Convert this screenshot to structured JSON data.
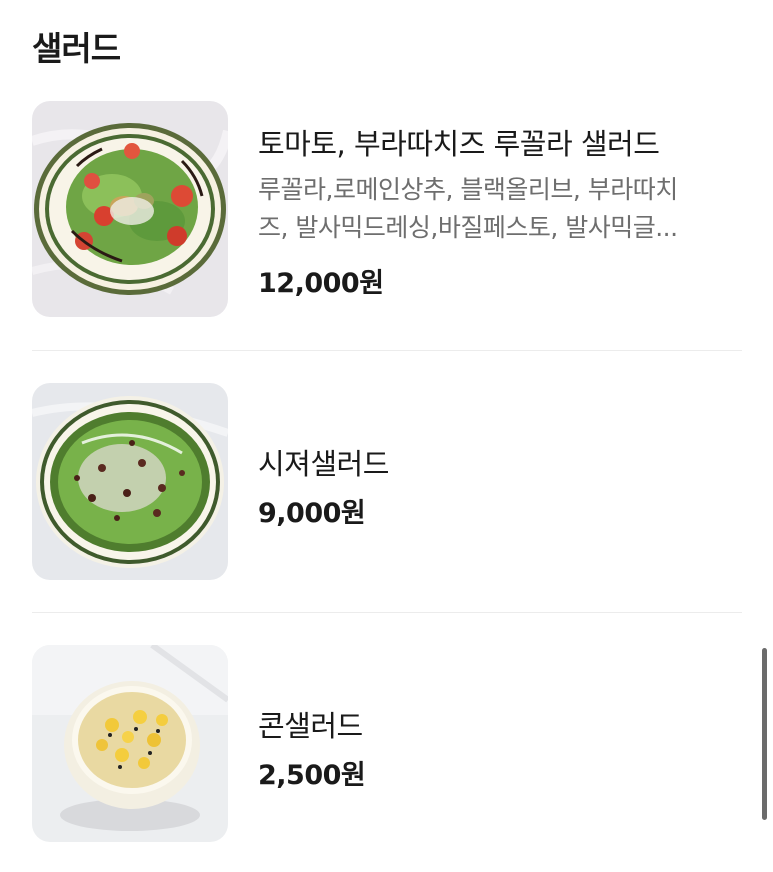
{
  "section": {
    "title": "샐러드"
  },
  "items": [
    {
      "name": "토마토, 부라따치즈 루꼴라 샐러드",
      "description_line1": "루꼴라,로메인상추, 블랙올리브, 부라따치",
      "description_line2": "즈, 발사믹드레싱,바질페스토, 발사믹글...",
      "price": "12,000원",
      "image": "tomato-burrata-arugula-salad-photo"
    },
    {
      "name": "시져샐러드",
      "price": "9,000원",
      "image": "caesar-salad-photo"
    },
    {
      "name": "콘샐러드",
      "price": "2,500원",
      "image": "corn-salad-photo"
    }
  ]
}
